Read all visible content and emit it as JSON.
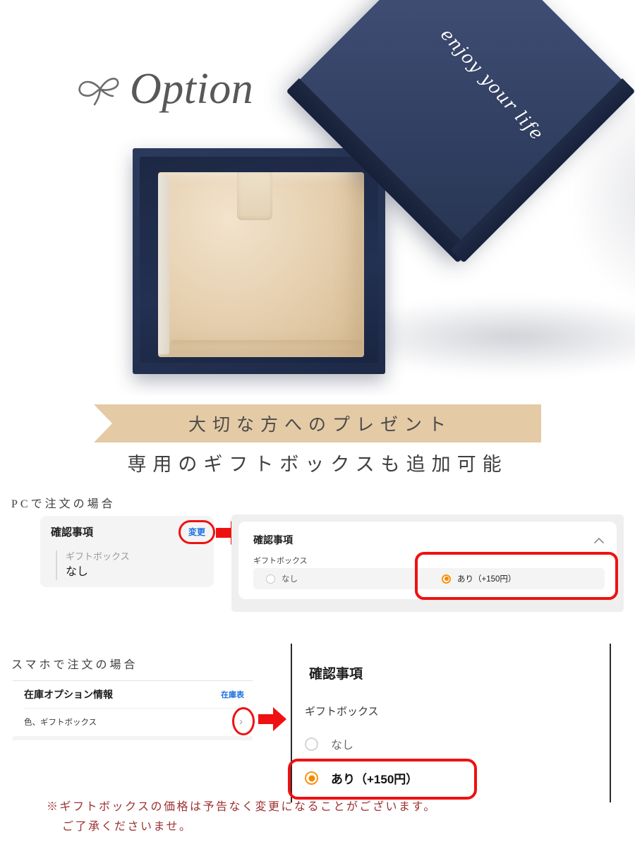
{
  "hero": {
    "title": "Option",
    "ribbon_icon": "ribbon-bow-icon",
    "box_lid_script": "enjoy your life"
  },
  "banner": {
    "text": "大切な方へのプレゼント",
    "color": "#e4caa5"
  },
  "sub_headline": "専用のギフトボックスも追加可能",
  "pc_section": {
    "label": "PCで注文の場合",
    "summary_card": {
      "title": "確認事項",
      "change_link": "変更",
      "option_label": "ギフトボックス",
      "option_value": "なし"
    },
    "expanded_panel": {
      "title": "確認事項",
      "collapse_icon": "chevron-up-icon",
      "option_label": "ギフトボックス",
      "options": [
        {
          "label": "なし",
          "selected": false
        },
        {
          "label": "あり（+150円）",
          "selected": true
        }
      ]
    }
  },
  "mobile_section": {
    "label": "スマホで注文の場合",
    "list": {
      "title": "在庫オプション情報",
      "link": "在庫表",
      "row_text": "色、ギフトボックス",
      "row_chevron": "›"
    },
    "panel": {
      "title": "確認事項",
      "option_label": "ギフトボックス",
      "options": [
        {
          "label": "なし",
          "selected": false
        },
        {
          "label": "あり（+150円）",
          "selected": true
        }
      ]
    }
  },
  "footer_note": {
    "line1": "※ギフトボックスの価格は予告なく変更になることがございます。",
    "line2": "ご了承くださいませ。",
    "color": "#9e3030"
  },
  "annotations": {
    "arrow_color": "#ef1111",
    "highlight_color": "#ef1111",
    "radio_selected_color": "#f28a00",
    "link_color": "#1a6fe0"
  }
}
